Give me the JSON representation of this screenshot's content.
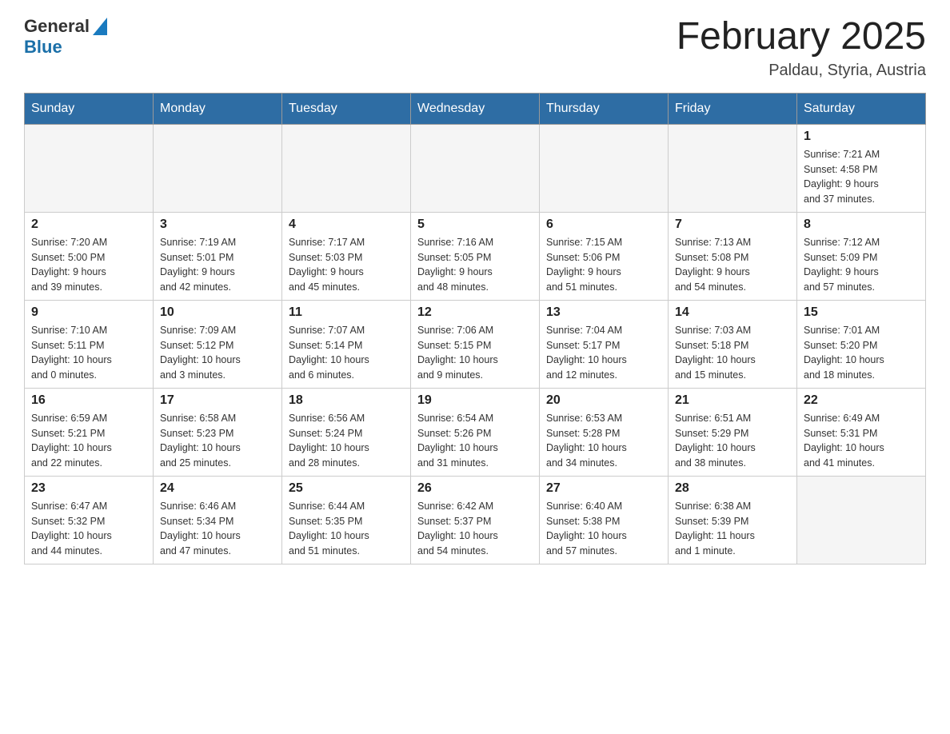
{
  "header": {
    "logo": {
      "text_general": "General",
      "text_blue": "Blue"
    },
    "month_title": "February 2025",
    "location": "Paldau, Styria, Austria"
  },
  "days_of_week": [
    "Sunday",
    "Monday",
    "Tuesday",
    "Wednesday",
    "Thursday",
    "Friday",
    "Saturday"
  ],
  "weeks": [
    [
      {
        "day": "",
        "info": ""
      },
      {
        "day": "",
        "info": ""
      },
      {
        "day": "",
        "info": ""
      },
      {
        "day": "",
        "info": ""
      },
      {
        "day": "",
        "info": ""
      },
      {
        "day": "",
        "info": ""
      },
      {
        "day": "1",
        "info": "Sunrise: 7:21 AM\nSunset: 4:58 PM\nDaylight: 9 hours\nand 37 minutes."
      }
    ],
    [
      {
        "day": "2",
        "info": "Sunrise: 7:20 AM\nSunset: 5:00 PM\nDaylight: 9 hours\nand 39 minutes."
      },
      {
        "day": "3",
        "info": "Sunrise: 7:19 AM\nSunset: 5:01 PM\nDaylight: 9 hours\nand 42 minutes."
      },
      {
        "day": "4",
        "info": "Sunrise: 7:17 AM\nSunset: 5:03 PM\nDaylight: 9 hours\nand 45 minutes."
      },
      {
        "day": "5",
        "info": "Sunrise: 7:16 AM\nSunset: 5:05 PM\nDaylight: 9 hours\nand 48 minutes."
      },
      {
        "day": "6",
        "info": "Sunrise: 7:15 AM\nSunset: 5:06 PM\nDaylight: 9 hours\nand 51 minutes."
      },
      {
        "day": "7",
        "info": "Sunrise: 7:13 AM\nSunset: 5:08 PM\nDaylight: 9 hours\nand 54 minutes."
      },
      {
        "day": "8",
        "info": "Sunrise: 7:12 AM\nSunset: 5:09 PM\nDaylight: 9 hours\nand 57 minutes."
      }
    ],
    [
      {
        "day": "9",
        "info": "Sunrise: 7:10 AM\nSunset: 5:11 PM\nDaylight: 10 hours\nand 0 minutes."
      },
      {
        "day": "10",
        "info": "Sunrise: 7:09 AM\nSunset: 5:12 PM\nDaylight: 10 hours\nand 3 minutes."
      },
      {
        "day": "11",
        "info": "Sunrise: 7:07 AM\nSunset: 5:14 PM\nDaylight: 10 hours\nand 6 minutes."
      },
      {
        "day": "12",
        "info": "Sunrise: 7:06 AM\nSunset: 5:15 PM\nDaylight: 10 hours\nand 9 minutes."
      },
      {
        "day": "13",
        "info": "Sunrise: 7:04 AM\nSunset: 5:17 PM\nDaylight: 10 hours\nand 12 minutes."
      },
      {
        "day": "14",
        "info": "Sunrise: 7:03 AM\nSunset: 5:18 PM\nDaylight: 10 hours\nand 15 minutes."
      },
      {
        "day": "15",
        "info": "Sunrise: 7:01 AM\nSunset: 5:20 PM\nDaylight: 10 hours\nand 18 minutes."
      }
    ],
    [
      {
        "day": "16",
        "info": "Sunrise: 6:59 AM\nSunset: 5:21 PM\nDaylight: 10 hours\nand 22 minutes."
      },
      {
        "day": "17",
        "info": "Sunrise: 6:58 AM\nSunset: 5:23 PM\nDaylight: 10 hours\nand 25 minutes."
      },
      {
        "day": "18",
        "info": "Sunrise: 6:56 AM\nSunset: 5:24 PM\nDaylight: 10 hours\nand 28 minutes."
      },
      {
        "day": "19",
        "info": "Sunrise: 6:54 AM\nSunset: 5:26 PM\nDaylight: 10 hours\nand 31 minutes."
      },
      {
        "day": "20",
        "info": "Sunrise: 6:53 AM\nSunset: 5:28 PM\nDaylight: 10 hours\nand 34 minutes."
      },
      {
        "day": "21",
        "info": "Sunrise: 6:51 AM\nSunset: 5:29 PM\nDaylight: 10 hours\nand 38 minutes."
      },
      {
        "day": "22",
        "info": "Sunrise: 6:49 AM\nSunset: 5:31 PM\nDaylight: 10 hours\nand 41 minutes."
      }
    ],
    [
      {
        "day": "23",
        "info": "Sunrise: 6:47 AM\nSunset: 5:32 PM\nDaylight: 10 hours\nand 44 minutes."
      },
      {
        "day": "24",
        "info": "Sunrise: 6:46 AM\nSunset: 5:34 PM\nDaylight: 10 hours\nand 47 minutes."
      },
      {
        "day": "25",
        "info": "Sunrise: 6:44 AM\nSunset: 5:35 PM\nDaylight: 10 hours\nand 51 minutes."
      },
      {
        "day": "26",
        "info": "Sunrise: 6:42 AM\nSunset: 5:37 PM\nDaylight: 10 hours\nand 54 minutes."
      },
      {
        "day": "27",
        "info": "Sunrise: 6:40 AM\nSunset: 5:38 PM\nDaylight: 10 hours\nand 57 minutes."
      },
      {
        "day": "28",
        "info": "Sunrise: 6:38 AM\nSunset: 5:39 PM\nDaylight: 11 hours\nand 1 minute."
      },
      {
        "day": "",
        "info": ""
      }
    ]
  ],
  "colors": {
    "header_bg": "#2e6da4",
    "accent_blue": "#1a6fa8"
  }
}
